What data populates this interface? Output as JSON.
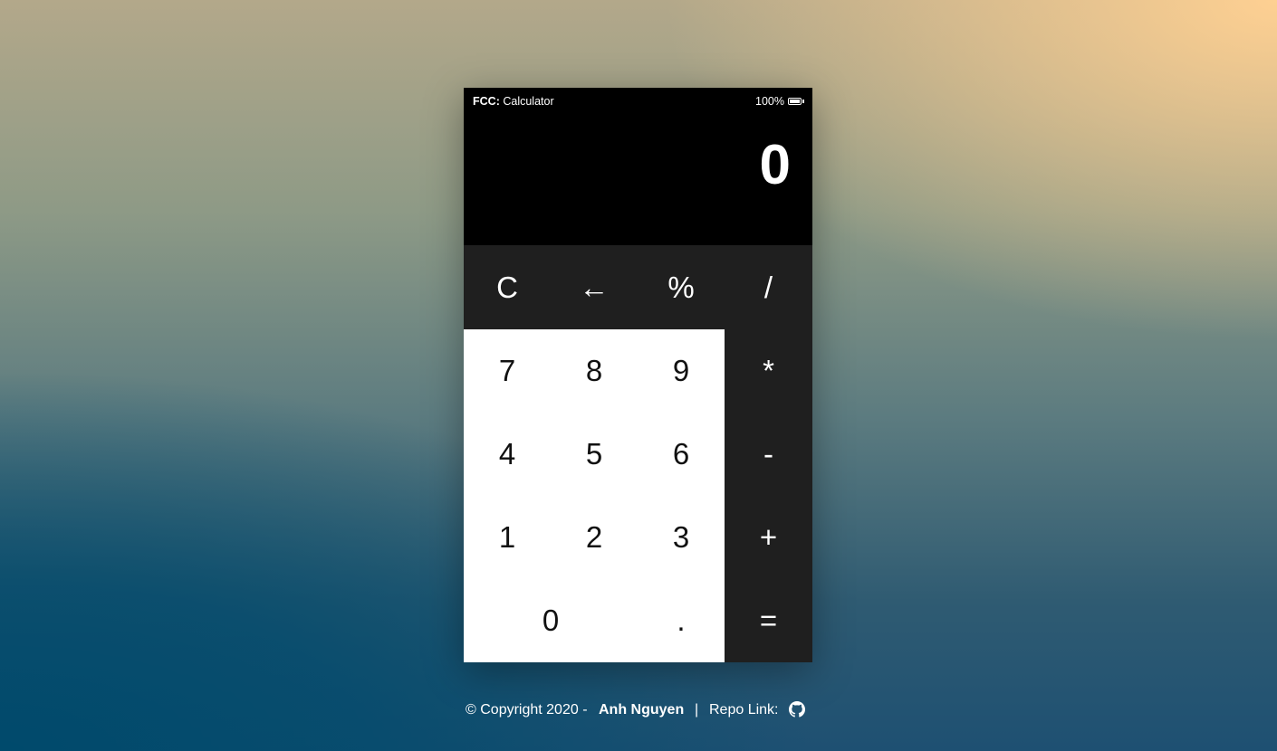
{
  "status_bar": {
    "app_prefix": "FCC:",
    "app_name": "Calculator",
    "battery": "100%"
  },
  "display": {
    "value": "0"
  },
  "keys": {
    "clear": "C",
    "backspace": "←",
    "percent": "%",
    "divide": "/",
    "seven": "7",
    "eight": "8",
    "nine": "9",
    "multiply": "*",
    "four": "4",
    "five": "5",
    "six": "6",
    "subtract": "-",
    "one": "1",
    "two": "2",
    "three": "3",
    "add": "+",
    "zero": "0",
    "decimal": ".",
    "equals": "="
  },
  "footer": {
    "copyright": "© Copyright 2020 -",
    "author": "Anh Nguyen",
    "separator": "|",
    "repo_label": "Repo Link:"
  },
  "colors": {
    "key_dark": "#1f1f1f",
    "key_light": "#ffffff",
    "screen": "#000000"
  },
  "icons": {
    "repo": "github-icon",
    "battery": "battery-icon"
  }
}
